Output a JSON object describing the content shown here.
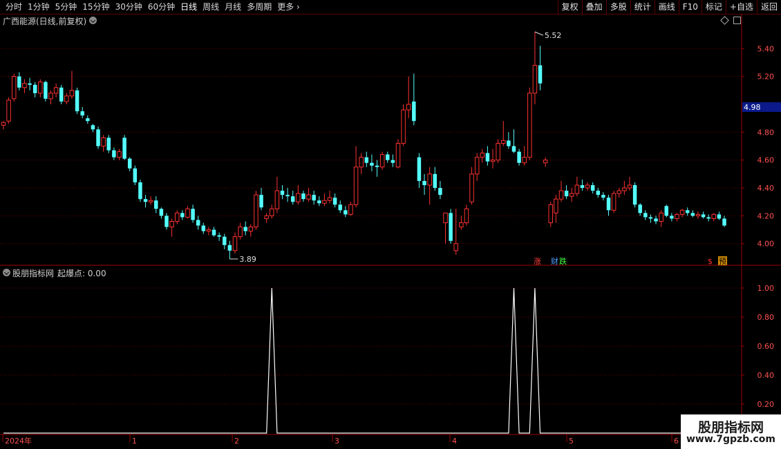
{
  "toolbar": {
    "periods": [
      "分时",
      "1分钟",
      "5分钟",
      "15分钟",
      "30分钟",
      "60分钟",
      "日线",
      "周线",
      "月线",
      "多周期",
      "更多"
    ],
    "active": "日线",
    "right_buttons": [
      "复权",
      "叠加",
      "多股",
      "统计",
      "画线",
      "F10",
      "标记",
      "+自选",
      "返回"
    ]
  },
  "main": {
    "title": "广西能源(日线,前复权)",
    "price_ticks": [
      "5.40",
      "5.20",
      "4.80",
      "4.60",
      "4.40",
      "4.20",
      "4.00"
    ],
    "current_price": "4.98",
    "high_label": "5.52",
    "low_label": "3.89",
    "marker_zhang": "涨",
    "marker_cai": "财",
    "marker_die": "跌",
    "marker_s": "$",
    "marker_yu": "预"
  },
  "indicator": {
    "title": "股朋指标网",
    "label": "起爆点: 0.00",
    "ticks": [
      "1.00",
      "0.80",
      "0.60",
      "0.40",
      "0.20"
    ]
  },
  "date_axis": [
    "2024年",
    "1",
    "2",
    "3",
    "4",
    "5",
    "6"
  ],
  "watermark": {
    "title": "股朋指标网",
    "url": "www.7gpzb.com"
  },
  "colors": {
    "up": "#ff3232",
    "down": "#54ffff",
    "grid": "#7a0000",
    "axis": "#a00000"
  },
  "chart_data": {
    "type": "candlestick",
    "ylim": [
      3.85,
      5.58
    ],
    "candles": [
      [
        4.85,
        4.88,
        4.82,
        4.87
      ],
      [
        4.88,
        5.05,
        4.86,
        5.03
      ],
      [
        5.04,
        5.22,
        5.02,
        5.2
      ],
      [
        5.2,
        5.23,
        5.1,
        5.12
      ],
      [
        5.12,
        5.18,
        5.08,
        5.15
      ],
      [
        5.15,
        5.19,
        5.1,
        5.14
      ],
      [
        5.14,
        5.16,
        5.05,
        5.08
      ],
      [
        5.08,
        5.18,
        5.05,
        5.16
      ],
      [
        5.16,
        5.17,
        5.02,
        5.04
      ],
      [
        5.04,
        5.1,
        5.0,
        5.08
      ],
      [
        5.08,
        5.15,
        5.05,
        5.12
      ],
      [
        5.12,
        5.14,
        5.0,
        5.02
      ],
      [
        5.02,
        5.08,
        5.0,
        5.06
      ],
      [
        5.06,
        5.24,
        5.04,
        5.1
      ],
      [
        5.1,
        5.12,
        4.93,
        4.95
      ],
      [
        4.95,
        4.98,
        4.9,
        4.92
      ],
      [
        4.9,
        4.92,
        4.86,
        4.88
      ],
      [
        4.85,
        4.86,
        4.8,
        4.82
      ],
      [
        4.82,
        4.84,
        4.68,
        4.7
      ],
      [
        4.7,
        4.78,
        4.66,
        4.76
      ],
      [
        4.76,
        4.78,
        4.65,
        4.67
      ],
      [
        4.67,
        4.69,
        4.6,
        4.62
      ],
      [
        4.62,
        4.68,
        4.6,
        4.66
      ],
      [
        4.76,
        4.78,
        4.6,
        4.61
      ],
      [
        4.61,
        4.62,
        4.52,
        4.54
      ],
      [
        4.54,
        4.56,
        4.42,
        4.44
      ],
      [
        4.44,
        4.46,
        4.3,
        4.32
      ],
      [
        4.32,
        4.35,
        4.26,
        4.3
      ],
      [
        4.3,
        4.34,
        4.28,
        4.31
      ],
      [
        4.31,
        4.34,
        4.22,
        4.25
      ],
      [
        4.25,
        4.26,
        4.18,
        4.2
      ],
      [
        4.2,
        4.22,
        4.1,
        4.12
      ],
      [
        4.12,
        4.18,
        4.05,
        4.16
      ],
      [
        4.16,
        4.24,
        4.14,
        4.22
      ],
      [
        4.22,
        4.24,
        4.17,
        4.19
      ],
      [
        4.19,
        4.27,
        4.18,
        4.25
      ],
      [
        4.25,
        4.28,
        4.15,
        4.17
      ],
      [
        4.17,
        4.2,
        4.1,
        4.13
      ],
      [
        4.13,
        4.15,
        4.07,
        4.09
      ],
      [
        4.09,
        4.12,
        4.06,
        4.1
      ],
      [
        4.1,
        4.12,
        4.05,
        4.06
      ],
      [
        4.06,
        4.08,
        4.02,
        4.05
      ],
      [
        4.05,
        4.07,
        3.96,
        3.99
      ],
      [
        3.99,
        4.02,
        3.89,
        3.95
      ],
      [
        3.95,
        4.08,
        3.93,
        4.05
      ],
      [
        4.05,
        4.15,
        4.03,
        4.12
      ],
      [
        4.12,
        4.16,
        4.06,
        4.09
      ],
      [
        4.09,
        4.14,
        4.05,
        4.12
      ],
      [
        4.12,
        4.38,
        4.1,
        4.35
      ],
      [
        4.35,
        4.4,
        4.24,
        4.26
      ],
      [
        4.18,
        4.22,
        4.15,
        4.2
      ],
      [
        4.2,
        4.28,
        4.18,
        4.25
      ],
      [
        4.25,
        4.48,
        4.22,
        4.38
      ],
      [
        4.38,
        4.42,
        4.32,
        4.35
      ],
      [
        4.35,
        4.4,
        4.3,
        4.34
      ],
      [
        4.34,
        4.38,
        4.28,
        4.3
      ],
      [
        4.3,
        4.42,
        4.28,
        4.36
      ],
      [
        4.36,
        4.38,
        4.3,
        4.32
      ],
      [
        4.32,
        4.4,
        4.3,
        4.35
      ],
      [
        4.35,
        4.38,
        4.28,
        4.31
      ],
      [
        4.31,
        4.34,
        4.27,
        4.29
      ],
      [
        4.29,
        4.36,
        4.27,
        4.31
      ],
      [
        4.31,
        4.38,
        4.29,
        4.33
      ],
      [
        4.33,
        4.36,
        4.26,
        4.28
      ],
      [
        4.28,
        4.31,
        4.22,
        4.24
      ],
      [
        4.24,
        4.27,
        4.19,
        4.21
      ],
      [
        4.21,
        4.3,
        4.2,
        4.28
      ],
      [
        4.28,
        4.7,
        4.26,
        4.55
      ],
      [
        4.55,
        4.65,
        4.5,
        4.62
      ],
      [
        4.62,
        4.66,
        4.55,
        4.58
      ],
      [
        4.58,
        4.64,
        4.52,
        4.56
      ],
      [
        4.56,
        4.6,
        4.48,
        4.55
      ],
      [
        4.55,
        4.66,
        4.53,
        4.64
      ],
      [
        4.64,
        4.66,
        4.58,
        4.6
      ],
      [
        4.6,
        4.64,
        4.55,
        4.58
      ],
      [
        4.55,
        4.75,
        4.54,
        4.72
      ],
      [
        4.72,
        5.0,
        4.7,
        4.96
      ],
      [
        4.96,
        5.2,
        4.9,
        5.0
      ],
      [
        5.02,
        5.22,
        4.85,
        4.88
      ],
      [
        4.62,
        4.65,
        4.4,
        4.45
      ],
      [
        4.45,
        4.5,
        4.35,
        4.42
      ],
      [
        4.42,
        4.55,
        4.28,
        4.5
      ],
      [
        4.5,
        4.55,
        4.38,
        4.4
      ],
      [
        4.4,
        4.45,
        4.32,
        4.35
      ],
      [
        4.15,
        4.22,
        4.0,
        4.22
      ],
      [
        4.22,
        4.25,
        4.0,
        4.02
      ],
      [
        3.95,
        4.25,
        3.92,
        4.0
      ],
      [
        4.12,
        4.2,
        4.1,
        4.15
      ],
      [
        4.15,
        4.28,
        4.13,
        4.25
      ],
      [
        4.3,
        4.55,
        4.28,
        4.5
      ],
      [
        4.5,
        4.65,
        4.45,
        4.62
      ],
      [
        4.62,
        4.68,
        4.58,
        4.65
      ],
      [
        4.65,
        4.7,
        4.56,
        4.59
      ],
      [
        4.59,
        4.68,
        4.54,
        4.6
      ],
      [
        4.6,
        4.75,
        4.58,
        4.72
      ],
      [
        4.72,
        4.88,
        4.7,
        4.74
      ],
      [
        4.74,
        4.8,
        4.68,
        4.7
      ],
      [
        4.7,
        4.82,
        4.65,
        4.66
      ],
      [
        4.66,
        4.68,
        4.56,
        4.58
      ],
      [
        4.58,
        4.7,
        4.56,
        4.62
      ],
      [
        4.62,
        5.12,
        4.6,
        5.08
      ],
      [
        5.08,
        5.52,
        5.0,
        5.28
      ],
      [
        5.28,
        5.42,
        5.1,
        5.15
      ],
      [
        4.58,
        4.62,
        4.55,
        4.6
      ],
      [
        4.15,
        4.3,
        4.12,
        4.28
      ],
      [
        4.22,
        4.35,
        4.15,
        4.32
      ],
      [
        4.32,
        4.45,
        4.3,
        4.38
      ],
      [
        4.38,
        4.42,
        4.32,
        4.34
      ],
      [
        4.34,
        4.4,
        4.3,
        4.36
      ],
      [
        4.36,
        4.48,
        4.34,
        4.42
      ],
      [
        4.42,
        4.46,
        4.38,
        4.4
      ],
      [
        4.4,
        4.44,
        4.38,
        4.42
      ],
      [
        4.42,
        4.44,
        4.36,
        4.38
      ],
      [
        4.38,
        4.4,
        4.33,
        4.35
      ],
      [
        4.35,
        4.37,
        4.31,
        4.33
      ],
      [
        4.33,
        4.35,
        4.2,
        4.24
      ],
      [
        4.24,
        4.38,
        4.22,
        4.36
      ],
      [
        4.36,
        4.4,
        4.33,
        4.38
      ],
      [
        4.38,
        4.45,
        4.35,
        4.4
      ],
      [
        4.4,
        4.48,
        4.38,
        4.42
      ],
      [
        4.42,
        4.44,
        4.26,
        4.28
      ],
      [
        4.28,
        4.29,
        4.2,
        4.22
      ],
      [
        4.22,
        4.24,
        4.17,
        4.19
      ],
      [
        4.19,
        4.21,
        4.15,
        4.18
      ],
      [
        4.18,
        4.2,
        4.14,
        4.16
      ],
      [
        4.16,
        4.24,
        4.12,
        4.22
      ],
      [
        4.27,
        4.28,
        4.19,
        4.2
      ],
      [
        4.2,
        4.22,
        4.16,
        4.18
      ],
      [
        4.18,
        4.22,
        4.16,
        4.21
      ],
      [
        4.21,
        4.25,
        4.19,
        4.24
      ],
      [
        4.24,
        4.26,
        4.2,
        4.22
      ],
      [
        4.22,
        4.24,
        4.19,
        4.2
      ],
      [
        4.2,
        4.23,
        4.18,
        4.21
      ],
      [
        4.21,
        4.23,
        4.18,
        4.19
      ],
      [
        4.19,
        4.21,
        4.16,
        4.18
      ],
      [
        4.18,
        4.22,
        4.16,
        4.21
      ],
      [
        4.21,
        4.23,
        4.17,
        4.18
      ],
      [
        4.18,
        4.2,
        4.12,
        4.13
      ]
    ],
    "indicator": {
      "name": "起爆点",
      "ylim": [
        0,
        1.1
      ],
      "spikes": [
        51,
        97,
        101
      ]
    }
  }
}
